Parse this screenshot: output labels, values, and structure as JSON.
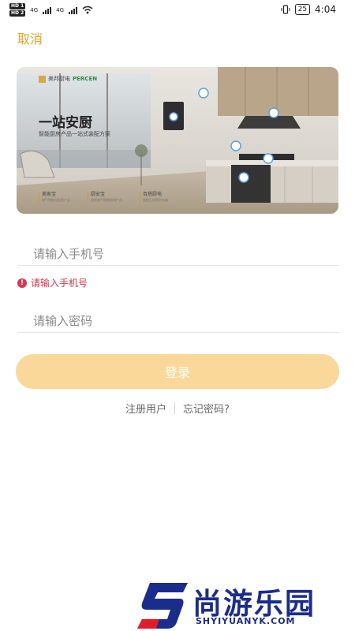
{
  "status_bar": {
    "sim1": "HD 1",
    "sim2": "HD 2",
    "net1": "4G",
    "net2": "4G",
    "battery": "25",
    "time": "4:04"
  },
  "header": {
    "cancel_label": "取消"
  },
  "banner": {
    "brand": "美邦厨电",
    "brand_en": "PERCEN",
    "title": "一站安厨",
    "subtitle": "智能厨房产品一站式装配方案",
    "tags": [
      {
        "title": "美家宝",
        "desc": "燃气智能化配套产品"
      },
      {
        "title": "厨安宝",
        "desc": "厨房燃气智能检测产品"
      },
      {
        "title": "百搭厨电",
        "desc": "智能互联厨房电器"
      }
    ]
  },
  "form": {
    "phone_placeholder": "请输入手机号",
    "phone_value": "",
    "error_text": "请输入手机号",
    "password_placeholder": "请输入密码",
    "password_value": "",
    "login_label": "登录"
  },
  "links": {
    "register": "注册用户",
    "forgot": "忘记密码?"
  },
  "watermark": {
    "text": "尚游乐园",
    "url": "SHYIYUANYK.COM"
  },
  "colors": {
    "accent": "#f0a31f",
    "login_button": "#fad89a",
    "error": "#e0334d",
    "watermark": "#1b2d8c"
  }
}
